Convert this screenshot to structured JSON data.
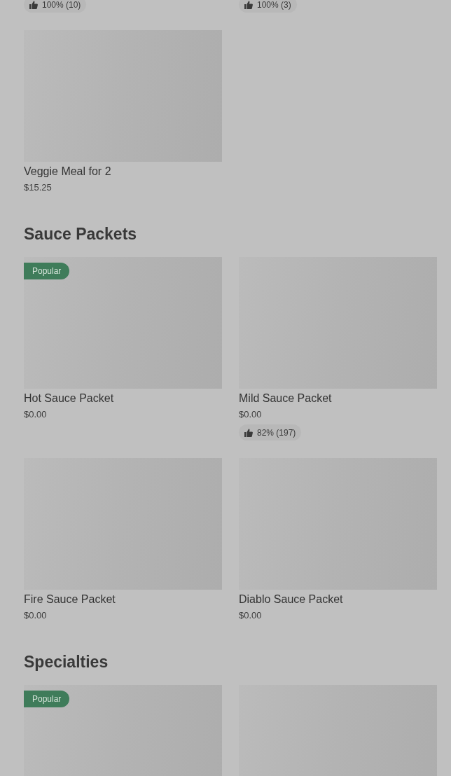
{
  "top_items": [
    {
      "rating": "100% (10)"
    },
    {
      "rating": "100% (3)"
    }
  ],
  "sections": [
    {
      "items": [
        {
          "kind": "picture",
          "name": "Veggie Meal for 2",
          "price": "$15.25"
        }
      ]
    },
    {
      "title": "Sauce Packets",
      "items": [
        {
          "kind": "picture",
          "badge": "Popular",
          "name": "Hot Sauce Packet",
          "price": "$0.00"
        },
        {
          "kind": "picture",
          "name": "Mild Sauce Packet",
          "price": "$0.00",
          "rating": "82% (197)"
        },
        {
          "kind": "picture",
          "name": "Fire Sauce Packet",
          "price": "$0.00"
        },
        {
          "kind": "picture",
          "name": "Diablo Sauce Packet",
          "price": "$0.00"
        }
      ]
    },
    {
      "title": "Specialties",
      "items": [
        {
          "kind": "picture",
          "badge": "Popular"
        },
        {
          "kind": "picture"
        }
      ]
    }
  ]
}
